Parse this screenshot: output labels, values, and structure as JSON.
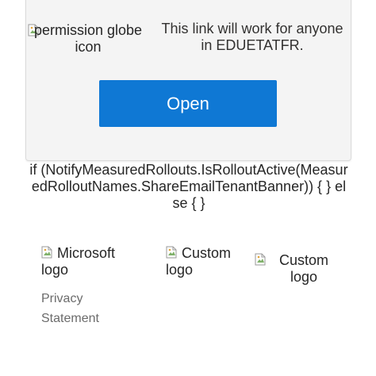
{
  "card": {
    "permission_icon_alt": "permission globe icon",
    "share_message": "This link will work for anyone in EDUETATFR.",
    "open_label": "Open"
  },
  "template_text": "if (NotifyMeasuredRollouts.IsRolloutActive(MeasuredRolloutNames.ShareEmailTenantBanner)) { } else { }",
  "footer": {
    "microsoft_logo_alt": "Microsoft logo",
    "custom_logo_alt_1": "Custom logo",
    "custom_logo_alt_2": "Custom logo",
    "privacy_label": "Privacy Statement"
  },
  "colors": {
    "button_blue": "#0f78d4",
    "card_background": "#f4f4f4",
    "link_gray": "#6b6b6b"
  },
  "icons": [
    "broken-image-icon"
  ]
}
